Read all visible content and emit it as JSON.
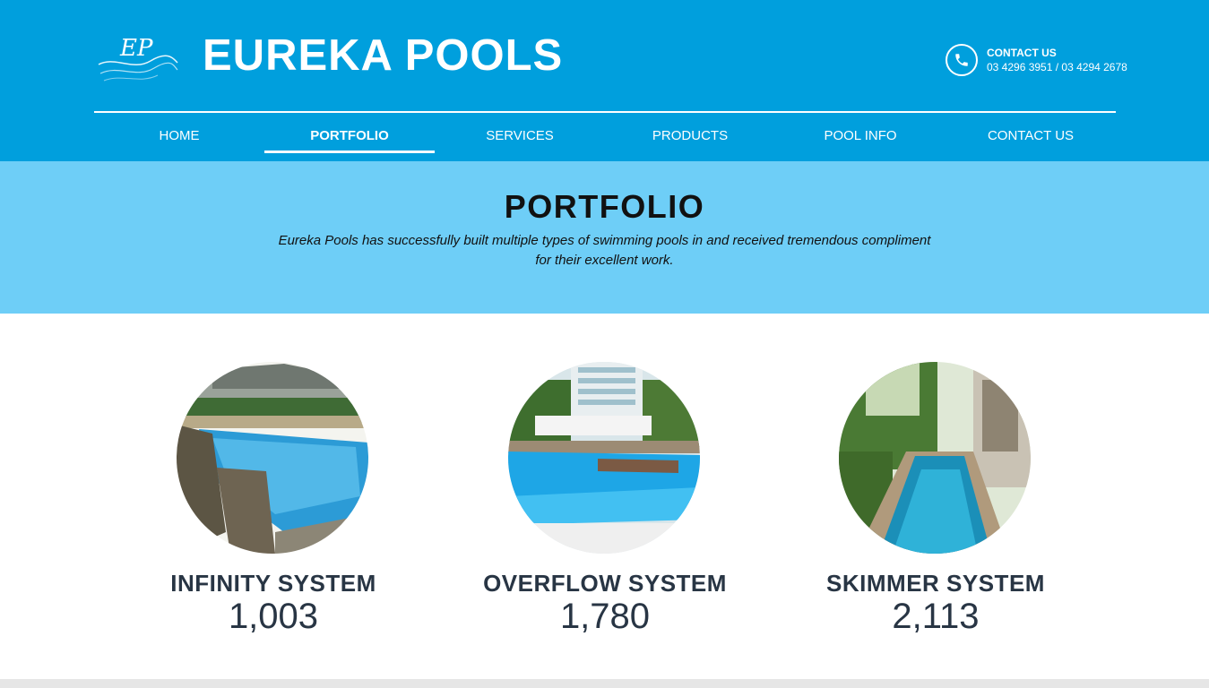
{
  "header": {
    "logo_initials": "EP",
    "brand": "EUREKA POOLS",
    "contact_title": "CONTACT US",
    "contact_phones": "03 4296 3951 / 03 4294 2678",
    "bg_color": "#009fdd"
  },
  "nav": {
    "items": [
      {
        "label": "HOME",
        "active": false
      },
      {
        "label": "PORTFOLIO",
        "active": true
      },
      {
        "label": "SERVICES",
        "active": false
      },
      {
        "label": "PRODUCTS",
        "active": false
      },
      {
        "label": "POOL INFO",
        "active": false
      },
      {
        "label": "CONTACT US",
        "active": false
      }
    ]
  },
  "banner": {
    "title": "PORTFOLIO",
    "text": "Eureka Pools has successfully built multiple types of swimming pools in and received tremendous compliment for their excellent work.",
    "bg_color": "#6ecef7"
  },
  "portfolio": [
    {
      "title": "INFINITY SYSTEM",
      "count": "1,003"
    },
    {
      "title": "OVERFLOW SYSTEM",
      "count": "1,780"
    },
    {
      "title": "SKIMMER SYSTEM",
      "count": "2,113"
    }
  ]
}
